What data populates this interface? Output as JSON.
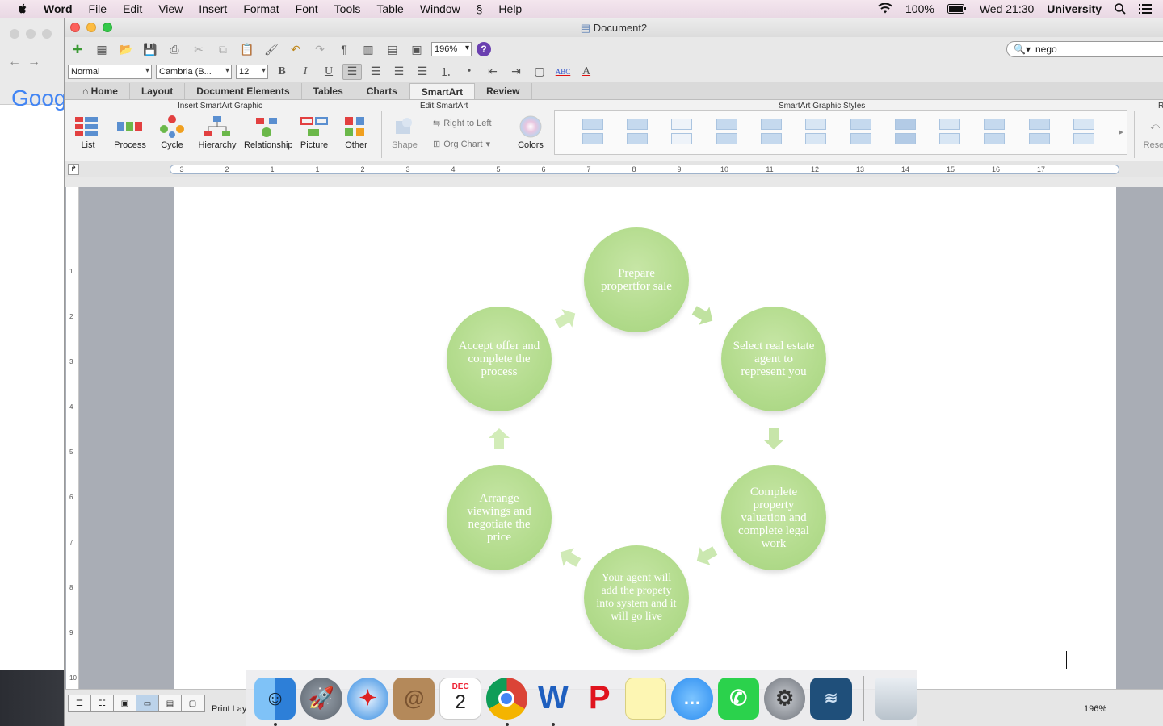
{
  "menubar": {
    "app": "Word",
    "items": [
      "File",
      "Edit",
      "View",
      "Insert",
      "Format",
      "Font",
      "Tools",
      "Table",
      "Window",
      "Help"
    ],
    "battery": "100%",
    "clock": "Wed 21:30",
    "user": "University"
  },
  "browser": {
    "logo_text": "Goog"
  },
  "window": {
    "title": "Document2"
  },
  "toolbar": {
    "zoom": "196%",
    "search_value": "nego"
  },
  "formatting": {
    "style": "Normal",
    "font": "Cambria (B...",
    "size": "12",
    "bold": "B",
    "italic": "I",
    "underline": "U"
  },
  "ribbon": {
    "tabs": [
      "Home",
      "Layout",
      "Document Elements",
      "Tables",
      "Charts",
      "SmartArt",
      "Review"
    ],
    "active_tab": "SmartArt",
    "groups": {
      "insert": "Insert SmartArt Graphic",
      "edit": "Edit SmartArt",
      "styles": "SmartArt Graphic Styles",
      "reset_group": "R"
    },
    "insert_buttons": [
      "List",
      "Process",
      "Cycle",
      "Hierarchy",
      "Relationship",
      "Picture",
      "Other"
    ],
    "edit_buttons": {
      "shape": "Shape",
      "rtl": "Right to Left",
      "org": "Org Chart",
      "colors": "Colors"
    },
    "reset": "Reset"
  },
  "ruler": {
    "numbers": [
      "3",
      "2",
      "1",
      "1",
      "2",
      "3",
      "4",
      "5",
      "6",
      "7",
      "8",
      "9",
      "10",
      "11",
      "12",
      "13",
      "14",
      "15",
      "16",
      "17"
    ],
    "vertical": [
      "1",
      "2",
      "3",
      "4",
      "5",
      "6",
      "7",
      "8",
      "9",
      "10"
    ]
  },
  "smartart": {
    "nodes": [
      "Prepare propertfor sale",
      "Select real estate agent to represent you",
      "Complete property valuation and complete legal work",
      "Your agent will add the propety into system and it will go live",
      "Arrange viewings and negotiate the price",
      "Accept offer and complete the process"
    ],
    "colors": {
      "node": "#b4dc8e",
      "arrow": "#c9e7ab"
    }
  },
  "statusbar": {
    "view_label": "Print Lay",
    "zoom": "196%"
  },
  "dock": {
    "calendar_month": "DEC",
    "calendar_day": "2",
    "apps": [
      "finder-icon",
      "launchpad-icon",
      "safari-icon",
      "contacts-icon",
      "calendar-icon",
      "chrome-icon",
      "word-icon",
      "acrobat-icon",
      "notes-icon",
      "messages-icon",
      "facetime-icon",
      "system-preferences-icon",
      "mysql-workbench-icon",
      "trash-icon"
    ]
  }
}
